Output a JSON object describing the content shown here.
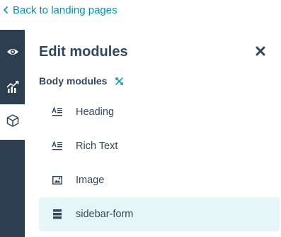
{
  "back_link": {
    "label": "Back to landing pages",
    "icon": "chevron-left-icon"
  },
  "rail": {
    "items": [
      {
        "icon": "eye-icon",
        "active": false
      },
      {
        "icon": "analytics-icon",
        "active": false
      },
      {
        "icon": "cube-icon",
        "active": true
      }
    ]
  },
  "panel": {
    "title": "Edit modules",
    "close_icon": "close-icon",
    "section": {
      "label": "Body modules",
      "icon": "collapse-arrows-icon"
    },
    "modules": [
      {
        "label": "Heading",
        "icon": "text-module-icon",
        "active": false
      },
      {
        "label": "Rich Text",
        "icon": "text-module-icon",
        "active": false
      },
      {
        "label": "Image",
        "icon": "image-icon",
        "active": false
      },
      {
        "label": "sidebar-form",
        "icon": "form-icon",
        "active": true
      }
    ]
  },
  "colors": {
    "link": "#0091ae",
    "rail_bg": "#2d3e50",
    "text": "#33475b",
    "active_row_bg": "#e5f5f8"
  }
}
